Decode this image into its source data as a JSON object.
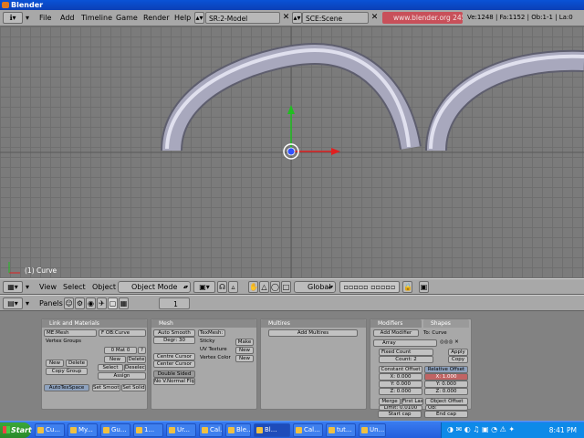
{
  "titlebar": {
    "title": "Blender"
  },
  "top_header": {
    "menus": [
      "File",
      "Add",
      "Timeline",
      "Game",
      "Render",
      "Help"
    ],
    "screen_field": "SR:2-Model",
    "scene_field": "SCE:Scene",
    "url": "www.blender.org 245",
    "stats": "Ve:1248 | Fa:1152 | Ob:1-1 | La:0"
  },
  "viewport": {
    "object_label": "(1) Curve"
  },
  "view_header": {
    "menus": [
      "View",
      "Select",
      "Object"
    ],
    "mode": "Object Mode",
    "orientation": "Global"
  },
  "buttons_header": {
    "panels_label": "Panels",
    "frame": "1"
  },
  "panels": {
    "link": {
      "title": "Link and Materials",
      "me": "ME:Mesh",
      "ob": "F OB:Curve",
      "vgroups": "Vertex Groups",
      "mat": "0 Mat 0",
      "new1": "New",
      "delete1": "Delete",
      "new2": "New",
      "delete2": "Delete",
      "copy_group": "Copy Group",
      "select": "Select",
      "deselect": "Deselect",
      "assign": "Assign",
      "autotex": "AutoTexSpace",
      "set_smooth": "Set Smooth",
      "set_solid": "Set Solid"
    },
    "mesh": {
      "title": "Mesh",
      "auto_smooth": "Auto Smooth",
      "degr": "Degr: 30",
      "center_cursor": "Centre Cursor",
      "center_cursor2": "Center Cursor",
      "double_sided": "Double Sided",
      "no_vnormal": "No V.Normal Flip",
      "texmesh": "TexMesh:",
      "sticky": "Sticky",
      "uv_texture": "UV Texture",
      "vertex_color": "Vertex Color",
      "make": "Make",
      "new_a": "New",
      "new_b": "New"
    },
    "multires": {
      "title": "Multires",
      "add": "Add Multires"
    },
    "modifiers": {
      "tab1": "Modifiers",
      "tab2": "Shapes",
      "add": "Add Modifier",
      "to": "To: Curve",
      "array": "Array",
      "fixed": "Fixed Count",
      "count": "Count: 2",
      "apply": "Apply",
      "copy": "Copy",
      "const": "Constant Offset",
      "rel": "Relative Offset",
      "cx": "X: 0.000",
      "cy": "Y: 0.000",
      "cz": "Z: 0.000",
      "rx": "X: 1.000",
      "ry": "Y: 0.000",
      "rz": "Z: 0.000",
      "merge": "Merge",
      "first_last": "First Last",
      "limit": "Limit: 0.0100",
      "obj_off": "Object Offset",
      "ob": "Ob:",
      "start_cap": "Start cap",
      "end_cap": "End cap"
    }
  },
  "taskbar": {
    "start": "Start",
    "tasks": [
      "Cu...",
      "My...",
      "Gu...",
      "1...",
      "Ur...",
      "Cal...",
      "Ble...",
      "Bl...",
      "Cal...",
      "tut...",
      "Un..."
    ],
    "clock": "8:41 PM"
  }
}
